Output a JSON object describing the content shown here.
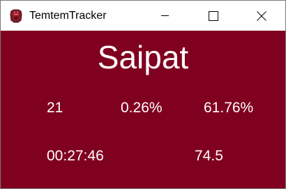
{
  "window": {
    "title": "TemtemTracker",
    "icon": "temtem-tracker-app-icon",
    "controls": [
      "minimize-icon",
      "maximize-icon",
      "close-icon"
    ]
  },
  "colors": {
    "background": "#800020",
    "text": "#ffffff",
    "titlebar": "#ffffff"
  },
  "tracker": {
    "temtem_name": "Saipat",
    "encounters": "21",
    "percentage": "0.26%",
    "luma_chance": "61.76%",
    "time_elapsed": "00:27:46",
    "per_hour": "74.5"
  }
}
